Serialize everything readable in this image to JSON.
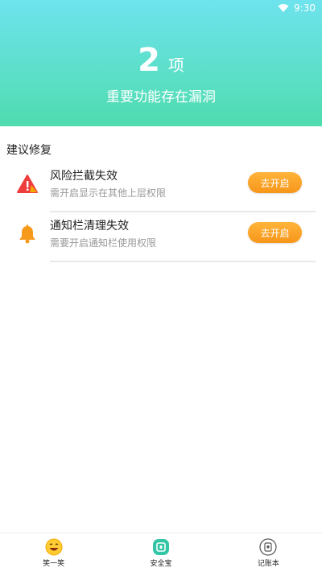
{
  "status_bar": {
    "time": "9:30",
    "wifi_icon": "wifi-icon"
  },
  "summary": {
    "count": "2",
    "unit": "项",
    "subtitle": "重要功能存在漏洞"
  },
  "section": {
    "title": "建议修复"
  },
  "items": [
    {
      "icon": "warning-triangle-icon",
      "name": "风险拦截失效",
      "desc": "需开启显示在其他上层权限",
      "action": "去开启"
    },
    {
      "icon": "bell-icon",
      "name": "通知栏清理失效",
      "desc": "需要开启通知栏使用权限",
      "action": "去开启"
    }
  ],
  "tabbar": {
    "tabs": [
      {
        "label": "笑一笑",
        "icon": "smiley-icon"
      },
      {
        "label": "安全宝",
        "icon": "shield-icon"
      },
      {
        "label": "记账本",
        "icon": "notebook-icon"
      }
    ],
    "active_index": 1
  },
  "colors": {
    "hero_top": "#6ee3ee",
    "hero_bottom": "#4fdcae",
    "action": "#f6961a"
  }
}
